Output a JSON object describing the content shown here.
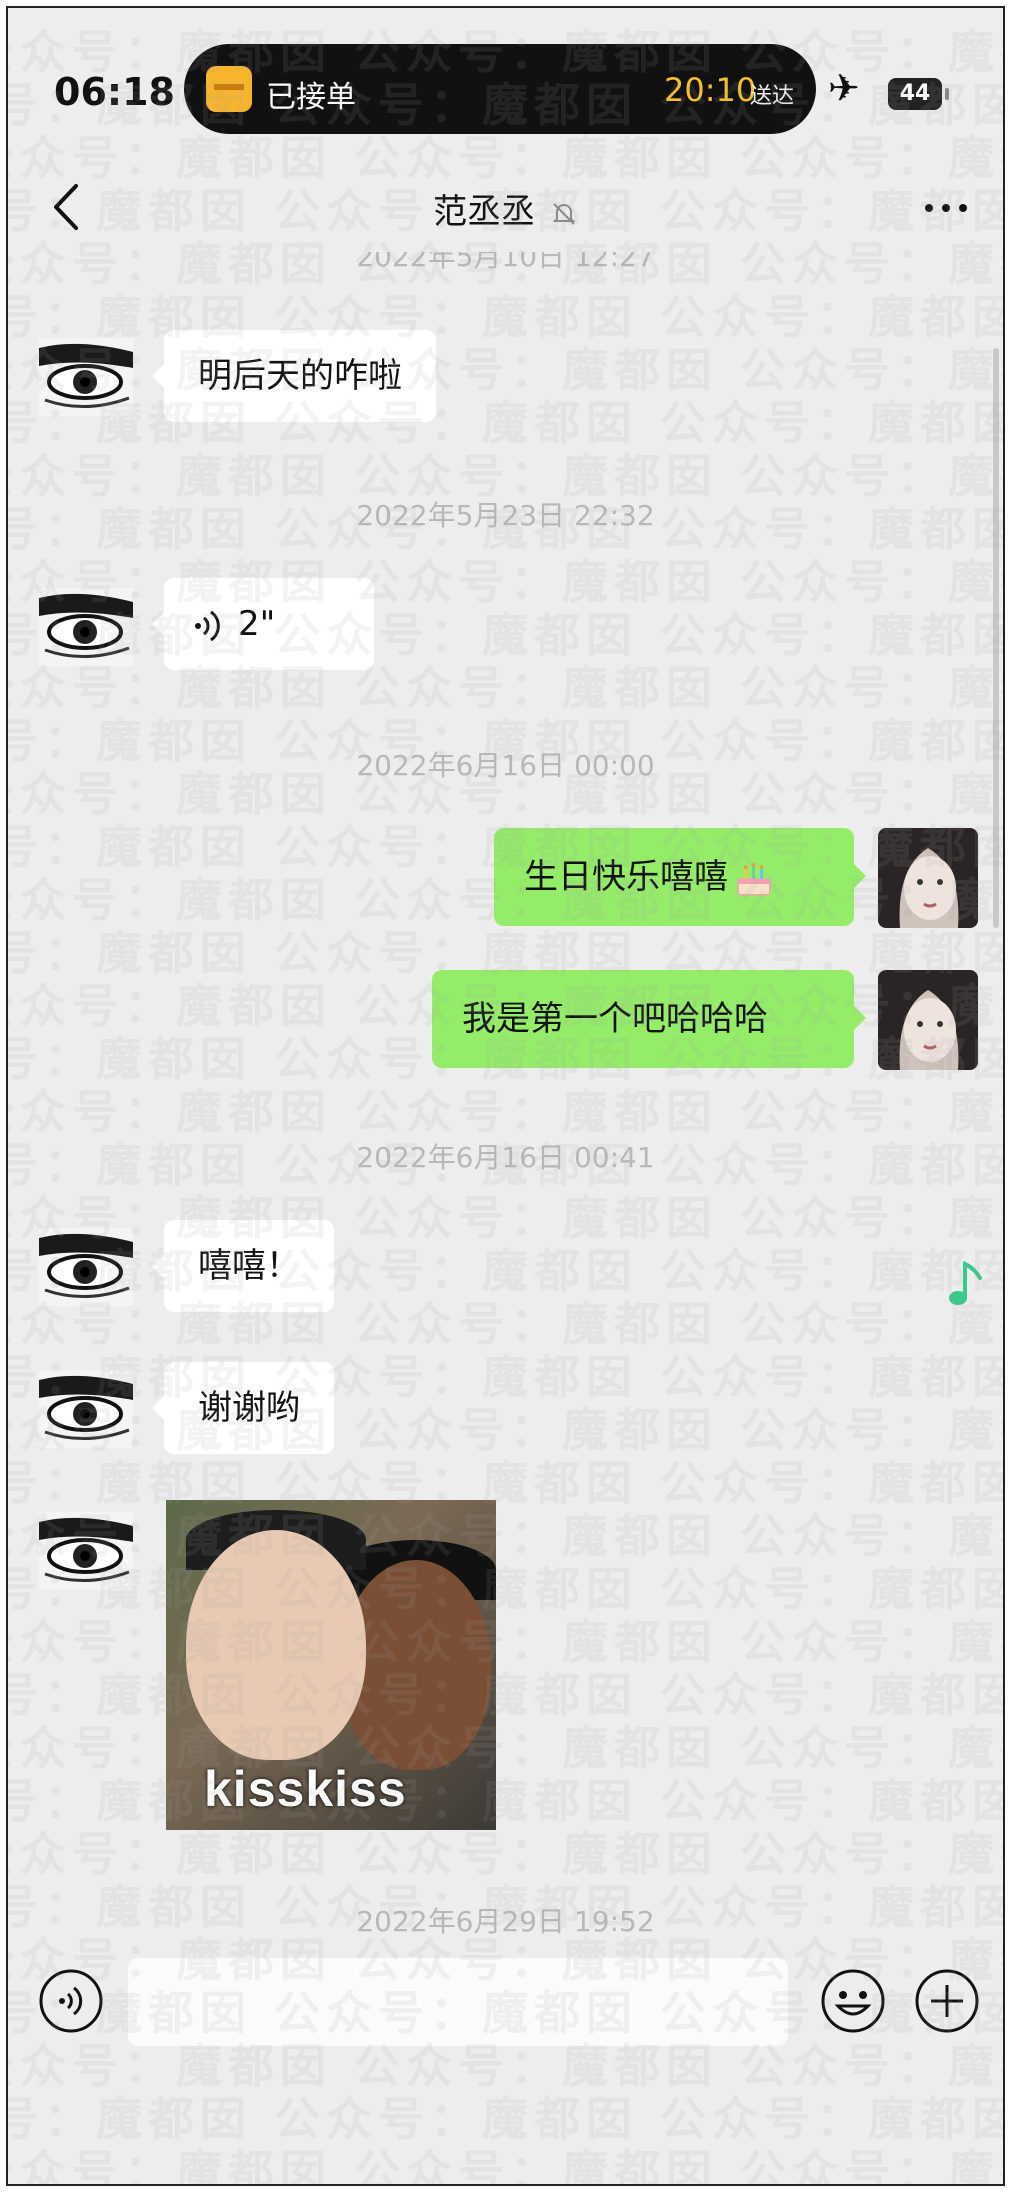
{
  "status_bar": {
    "time": "06:18",
    "live_activity": {
      "status": "已接单",
      "eta_time": "20:10",
      "eta_label": "送达"
    },
    "battery": "44",
    "icons": [
      "airplane-icon",
      "battery-icon",
      "package-icon"
    ]
  },
  "header": {
    "title": "范丞丞",
    "muted": true,
    "icons": [
      "back-icon",
      "mute-bell-icon",
      "more-icon"
    ]
  },
  "messages": [
    {
      "type": "timestamp",
      "text": "2022年5月10日 12:27"
    },
    {
      "type": "text",
      "direction": "in",
      "text": "明后天的咋啦"
    },
    {
      "type": "timestamp",
      "text": "2022年5月23日 22:32"
    },
    {
      "type": "voice",
      "direction": "in",
      "duration": "2\""
    },
    {
      "type": "timestamp",
      "text": "2022年6月16日 00:00"
    },
    {
      "type": "text",
      "direction": "out",
      "text": "生日快乐嘻嘻",
      "emoji": "cake-icon"
    },
    {
      "type": "text",
      "direction": "out",
      "text": "我是第一个吧哈哈哈"
    },
    {
      "type": "timestamp",
      "text": "2022年6月16日 00:41"
    },
    {
      "type": "text",
      "direction": "in",
      "text": "嘻嘻！"
    },
    {
      "type": "text",
      "direction": "in",
      "text": "谢谢哟"
    },
    {
      "type": "sticker",
      "direction": "in",
      "caption": "kisskiss"
    },
    {
      "type": "timestamp",
      "text": "2022年6月29日 19:52"
    }
  ],
  "input_bar": {
    "icons": [
      "voice-input-icon",
      "emoji-icon",
      "plus-icon"
    ]
  },
  "watermark": "公众号：魔都囡",
  "colors": {
    "outgoing_bubble": "#95ec69",
    "background": "#ededed",
    "incoming_bubble": "#ffffff",
    "music_icon": "#3bc98a"
  }
}
